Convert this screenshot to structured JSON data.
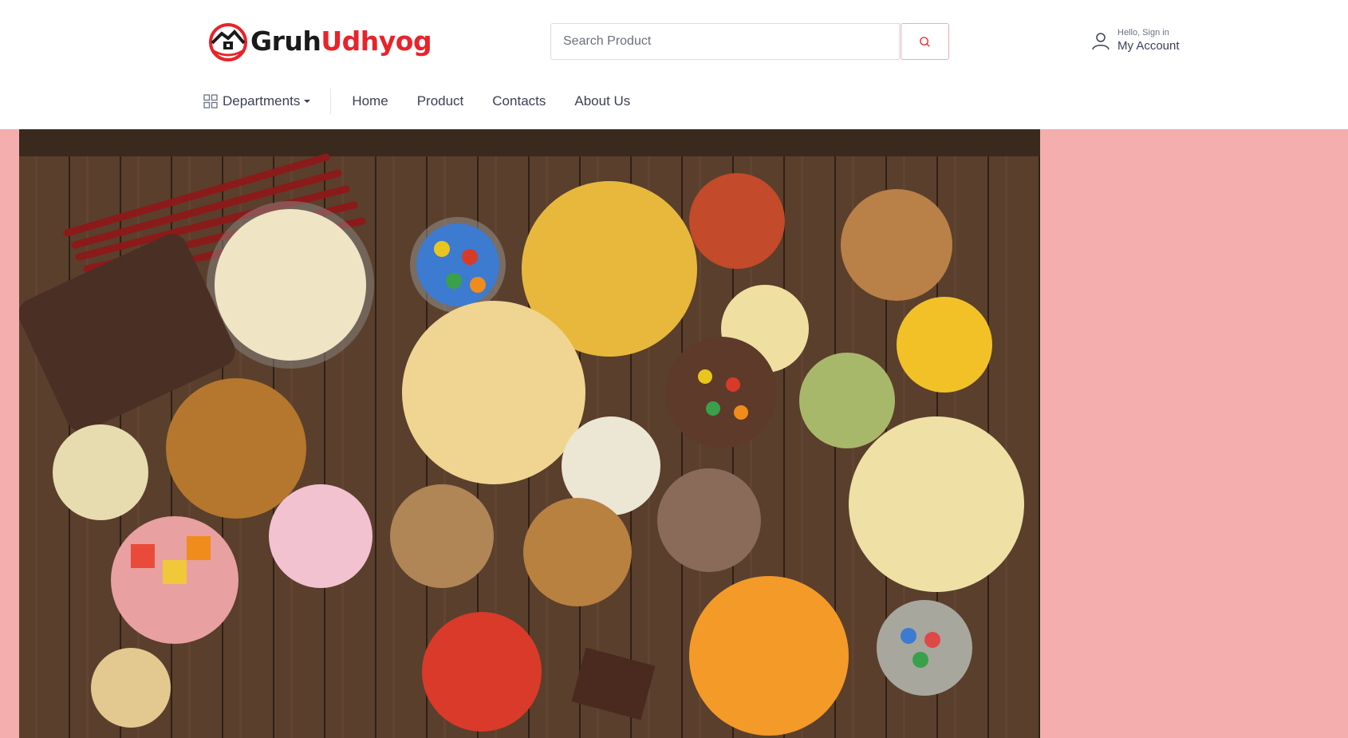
{
  "header": {
    "logo": {
      "part1": "Gruh",
      "part2": "Udhyog"
    },
    "search": {
      "placeholder": "Search Product",
      "value": ""
    },
    "account": {
      "greeting": "Hello, Sign in",
      "label": "My Account"
    }
  },
  "nav": {
    "departments_label": "Departments",
    "links": [
      "Home",
      "Product",
      "Contacts",
      "About Us"
    ]
  },
  "colors": {
    "brand_red": "#e8232a",
    "hero_background": "#f4aeae",
    "text_dark": "#3a4155"
  },
  "icons": [
    "logo-mark-icon",
    "search-icon",
    "user-icon",
    "grid-icon",
    "caret-down-icon"
  ]
}
